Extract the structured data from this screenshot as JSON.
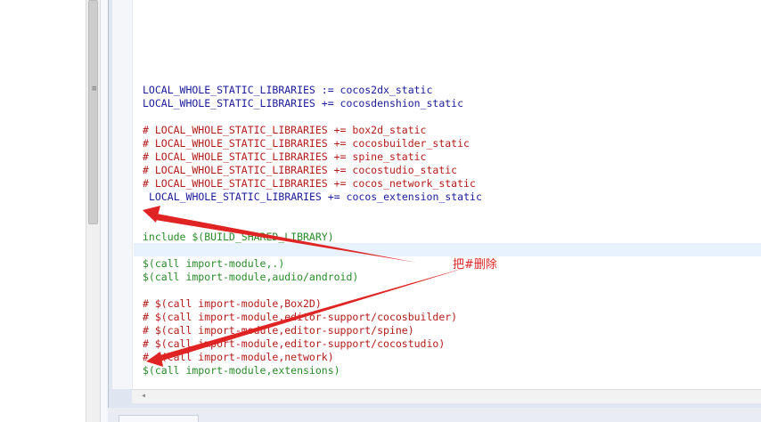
{
  "editor": {
    "lines": [
      {
        "text": "LOCAL_WHOLE_STATIC_LIBRARIES := cocos2dx_static",
        "style": "blue"
      },
      {
        "text": "LOCAL_WHOLE_STATIC_LIBRARIES += cocosdenshion_static",
        "style": "blue"
      },
      {
        "text": "# LOCAL_WHOLE_STATIC_LIBRARIES += box2d_static",
        "style": "red"
      },
      {
        "text": "# LOCAL_WHOLE_STATIC_LIBRARIES += cocosbuilder_static",
        "style": "red"
      },
      {
        "text": "# LOCAL_WHOLE_STATIC_LIBRARIES += spine_static",
        "style": "red"
      },
      {
        "text": "# LOCAL_WHOLE_STATIC_LIBRARIES += cocostudio_static",
        "style": "red"
      },
      {
        "text": "# LOCAL_WHOLE_STATIC_LIBRARIES += cocos_network_static",
        "style": "red"
      },
      {
        "text": "LOCAL_WHOLE_STATIC_LIBRARIES += cocos_extension_static",
        "style": "blue"
      },
      {
        "text": "include $(BUILD_SHARED_LIBRARY)",
        "style": "green"
      },
      {
        "text": "$(call import-module,.)",
        "style": "green"
      },
      {
        "text": "$(call import-module,audio/android)",
        "style": "green"
      },
      {
        "text": "# $(call import-module,Box2D)",
        "style": "red"
      },
      {
        "text": "# $(call import-module,editor-support/cocosbuilder)",
        "style": "red"
      },
      {
        "text": "# $(call import-module,editor-support/spine)",
        "style": "red"
      },
      {
        "text": "# $(call import-module,editor-support/cocostudio)",
        "style": "red"
      },
      {
        "text": "# $(call import-module,network)",
        "style": "red"
      },
      {
        "text": "$(call import-module,extensions)",
        "style": "green"
      }
    ]
  },
  "annotation": {
    "text": "把#删除",
    "color": "#e02424"
  },
  "colors": {
    "keyword": "#1a1a9a",
    "comment": "#b51a1a",
    "directive": "#2a8a2a"
  },
  "icons": {
    "grip": "grip-lines-icon",
    "scroll_left": "triangle-left-icon"
  }
}
